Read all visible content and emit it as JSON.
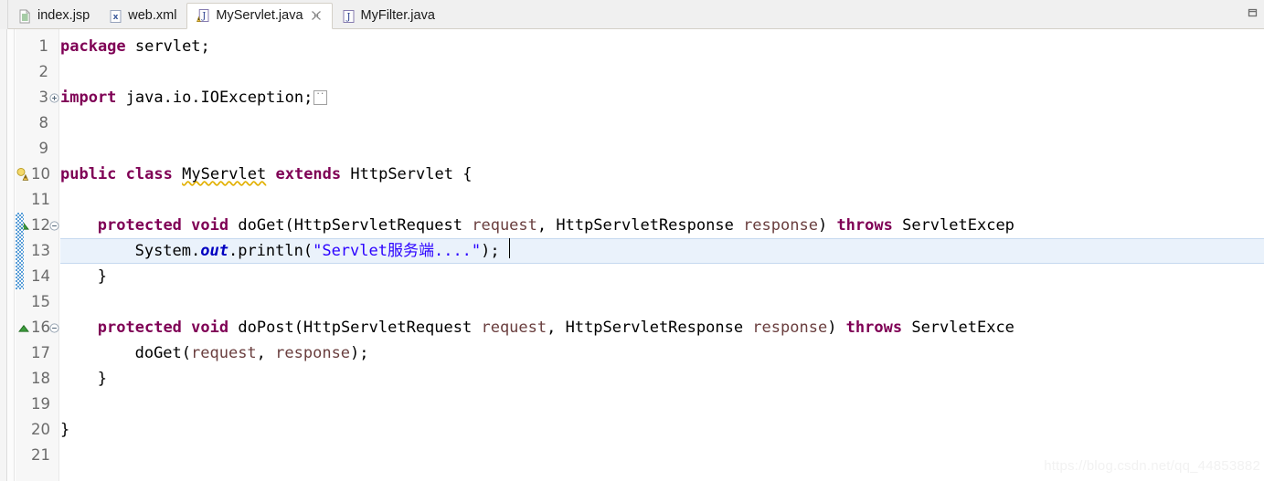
{
  "window": {
    "maximize_icon": "restore-icon"
  },
  "tabbar": {
    "tabs": [
      {
        "label": "index.jsp",
        "icon": "jsp-file-icon",
        "active": false,
        "closable": false
      },
      {
        "label": "web.xml",
        "icon": "xml-file-icon",
        "active": false,
        "closable": false
      },
      {
        "label": "MyServlet.java",
        "icon": "java-file-warning-icon",
        "active": true,
        "closable": true,
        "close_icon": "close-icon"
      },
      {
        "label": "MyFilter.java",
        "icon": "java-file-icon",
        "active": false,
        "closable": false
      }
    ]
  },
  "editor": {
    "language": "java",
    "highlighted_line": 13,
    "caret_line": 13,
    "lines": [
      {
        "number": "1",
        "indent": 0,
        "tokens": [
          {
            "t": "package",
            "c": "kw"
          },
          {
            "t": " servlet;",
            "c": "pln"
          }
        ]
      },
      {
        "number": "2",
        "indent": 0,
        "tokens": []
      },
      {
        "number": "3",
        "indent": 0,
        "folded": true,
        "fold_widget": "expand-icon",
        "tokens": [
          {
            "t": "import",
            "c": "kw"
          },
          {
            "t": " java.io.IOException;",
            "c": "pln"
          },
          {
            "t": "",
            "c": "foldbox"
          }
        ]
      },
      {
        "number": "8",
        "indent": 0,
        "tokens": []
      },
      {
        "number": "9",
        "indent": 0,
        "tokens": []
      },
      {
        "number": "10",
        "indent": 0,
        "annotation": "warning-icon",
        "tokens": [
          {
            "t": "public",
            "c": "kw"
          },
          {
            "t": " ",
            "c": "pln"
          },
          {
            "t": "class",
            "c": "kw"
          },
          {
            "t": " ",
            "c": "pln"
          },
          {
            "t": "MyServlet",
            "c": "warnu"
          },
          {
            "t": " ",
            "c": "pln"
          },
          {
            "t": "extends",
            "c": "kw"
          },
          {
            "t": " HttpServlet {",
            "c": "pln"
          }
        ]
      },
      {
        "number": "11",
        "indent": 0,
        "tokens": []
      },
      {
        "number": "12",
        "indent": 4,
        "changed": true,
        "annotation": "override-marker-icon",
        "fold_widget": "collapse-icon",
        "tokens": [
          {
            "t": "protected",
            "c": "kw"
          },
          {
            "t": " ",
            "c": "pln"
          },
          {
            "t": "void",
            "c": "kw"
          },
          {
            "t": " doGet(HttpServletRequest ",
            "c": "pln"
          },
          {
            "t": "request",
            "c": "par"
          },
          {
            "t": ", HttpServletResponse ",
            "c": "pln"
          },
          {
            "t": "response",
            "c": "par"
          },
          {
            "t": ") ",
            "c": "pln"
          },
          {
            "t": "throws",
            "c": "kw"
          },
          {
            "t": " ServletExcep",
            "c": "pln"
          }
        ]
      },
      {
        "number": "13",
        "indent": 8,
        "changed": true,
        "tokens": [
          {
            "t": "System.",
            "c": "pln"
          },
          {
            "t": "out",
            "c": "fld"
          },
          {
            "t": ".println(",
            "c": "pln"
          },
          {
            "t": "\"Servlet服务端....\"",
            "c": "str"
          },
          {
            "t": ");",
            "c": "pln"
          }
        ]
      },
      {
        "number": "14",
        "indent": 4,
        "changed": true,
        "tokens": [
          {
            "t": "}",
            "c": "pln"
          }
        ]
      },
      {
        "number": "15",
        "indent": 0,
        "tokens": []
      },
      {
        "number": "16",
        "indent": 4,
        "annotation": "override-marker-icon",
        "fold_widget": "collapse-icon",
        "tokens": [
          {
            "t": "protected",
            "c": "kw"
          },
          {
            "t": " ",
            "c": "pln"
          },
          {
            "t": "void",
            "c": "kw"
          },
          {
            "t": " doPost(HttpServletRequest ",
            "c": "pln"
          },
          {
            "t": "request",
            "c": "par"
          },
          {
            "t": ", HttpServletResponse ",
            "c": "pln"
          },
          {
            "t": "response",
            "c": "par"
          },
          {
            "t": ") ",
            "c": "pln"
          },
          {
            "t": "throws",
            "c": "kw"
          },
          {
            "t": " ServletExce",
            "c": "pln"
          }
        ]
      },
      {
        "number": "17",
        "indent": 8,
        "tokens": [
          {
            "t": "doGet(",
            "c": "pln"
          },
          {
            "t": "request",
            "c": "par"
          },
          {
            "t": ", ",
            "c": "pln"
          },
          {
            "t": "response",
            "c": "par"
          },
          {
            "t": ");",
            "c": "pln"
          }
        ]
      },
      {
        "number": "18",
        "indent": 4,
        "tokens": [
          {
            "t": "}",
            "c": "pln"
          }
        ]
      },
      {
        "number": "19",
        "indent": 0,
        "tokens": []
      },
      {
        "number": "20",
        "indent": 0,
        "tokens": [
          {
            "t": "}",
            "c": "pln"
          }
        ]
      },
      {
        "number": "21",
        "indent": 0,
        "tokens": []
      }
    ]
  },
  "watermark": {
    "text": "https://blog.csdn.net/qq_44853882"
  },
  "colors": {
    "keyword": "#7f0055",
    "string": "#2a00ff",
    "field": "#0000c0",
    "parameter": "#6a3e3e",
    "line_number": "#6b6b6b",
    "highlight_line": "#eaf2fb",
    "change_bar": "#3f8fd2",
    "tab_active_bg": "#ffffff",
    "tabbar_bg": "#f0f0f0",
    "gutter_bg": "#f7f7f7"
  }
}
